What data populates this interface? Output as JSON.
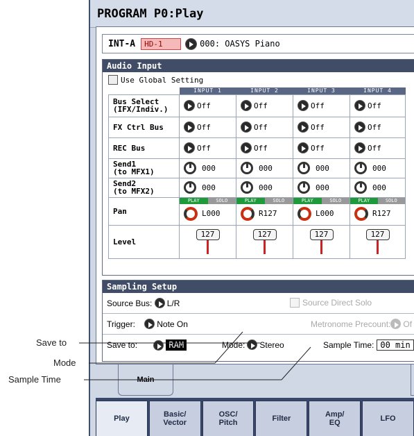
{
  "callouts": {
    "save_to": "Save to",
    "mode": "Mode",
    "sample_time": "Sample Time"
  },
  "page": {
    "title": "PROGRAM P0:Play"
  },
  "program": {
    "bank": "INT-A",
    "hd_badge": "HD-1",
    "number_name": "000: OASYS Piano"
  },
  "audio_input": {
    "title": "Audio Input",
    "use_global": "Use Global Setting",
    "columns": [
      "INPUT 1",
      "INPUT 2",
      "INPUT 3",
      "INPUT 4"
    ],
    "rows": {
      "bus_select": {
        "label": "Bus Select\n(IFX/Indiv.)",
        "values": [
          "Off",
          "Off",
          "Off",
          "Off"
        ]
      },
      "fx_ctrl": {
        "label": "FX Ctrl Bus",
        "values": [
          "Off",
          "Off",
          "Off",
          "Off"
        ]
      },
      "rec_bus": {
        "label": "REC Bus",
        "values": [
          "Off",
          "Off",
          "Off",
          "Off"
        ]
      },
      "send1": {
        "label": "Send1\n(to MFX1)",
        "values": [
          "000",
          "000",
          "000",
          "000"
        ]
      },
      "send2": {
        "label": "Send2\n(to MFX2)",
        "values": [
          "000",
          "000",
          "000",
          "000"
        ]
      },
      "pan": {
        "label": "Pan",
        "values": [
          "L000",
          "R127",
          "L000",
          "R127"
        ]
      },
      "level": {
        "label": "Level",
        "values": [
          "127",
          "127",
          "127",
          "127"
        ]
      }
    },
    "play_label": "PLAY",
    "solo_label": "SOLO"
  },
  "sampling": {
    "title": "Sampling Setup",
    "source_bus_label": "Source Bus:",
    "source_bus_value": "L/R",
    "source_direct_solo": "Source Direct Solo",
    "trigger_label": "Trigger:",
    "trigger_value": "Note On",
    "metronome_label": "Metronome Precount:",
    "metronome_value": "Of",
    "save_to_label": "Save to:",
    "save_to_value": "RAM",
    "mode_label": "Mode:",
    "mode_value": "Stereo",
    "sample_time_label": "Sample Time:",
    "sample_time_value": "00 min"
  },
  "tabs": {
    "main": "Main",
    "bottom": [
      "Play",
      "Basic/\nVector",
      "OSC/\nPitch",
      "Filter",
      "Amp/\nEQ",
      "LFO"
    ]
  }
}
